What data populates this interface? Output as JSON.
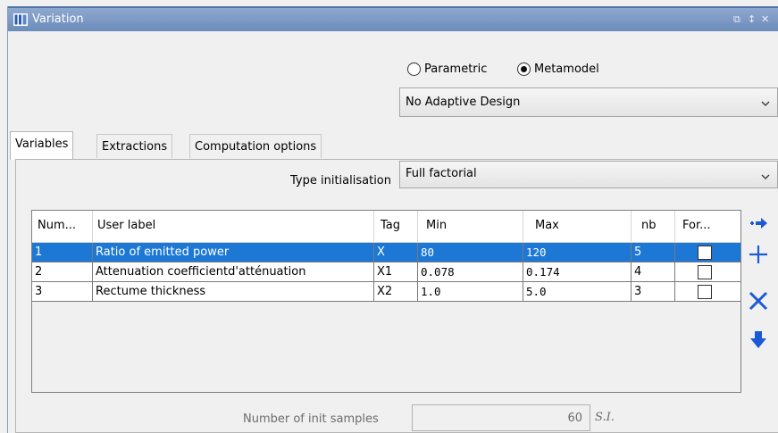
{
  "window": {
    "title": "Variation",
    "controls": [
      "⧉",
      "↕",
      "✕"
    ]
  },
  "mode": {
    "options": [
      "Parametric",
      "Metamodel"
    ],
    "selected": "Metamodel"
  },
  "adaptive_design": {
    "value": "No Adaptive Design"
  },
  "tabs": [
    {
      "label": "Variables",
      "active": true
    },
    {
      "label": "Extractions",
      "active": false
    },
    {
      "label": "Computation options",
      "active": false
    }
  ],
  "type_initialisation": {
    "label": "Type initialisation",
    "value": "Full factorial"
  },
  "table": {
    "columns": [
      "Num...",
      "User label",
      "Tag",
      "Min",
      "Max",
      "nb",
      "For..."
    ],
    "rows": [
      {
        "num": "1",
        "label": "Ratio of emitted power",
        "tag": "X",
        "min": "80",
        "max": "120",
        "nb": "5",
        "for": false,
        "selected": true
      },
      {
        "num": "2",
        "label": "Attenuation coefficientd'atténuation",
        "tag": "X1",
        "min": "0.078",
        "max": "0.174",
        "nb": "4",
        "for": false,
        "selected": false
      },
      {
        "num": "3",
        "label": "Rectume thickness",
        "tag": "X2",
        "min": "1.0",
        "max": "5.0",
        "nb": "3",
        "for": false,
        "selected": false
      }
    ]
  },
  "side_actions": [
    "move-right-icon",
    "add-icon",
    "delete-icon",
    "move-down-icon"
  ],
  "init_samples": {
    "label": "Number of init samples",
    "value": "60",
    "unit": "S.I."
  },
  "colors": {
    "accent": "#1c78d4",
    "titlebar": "#7d9ac6",
    "icon_blue": "#1a5ad7"
  }
}
